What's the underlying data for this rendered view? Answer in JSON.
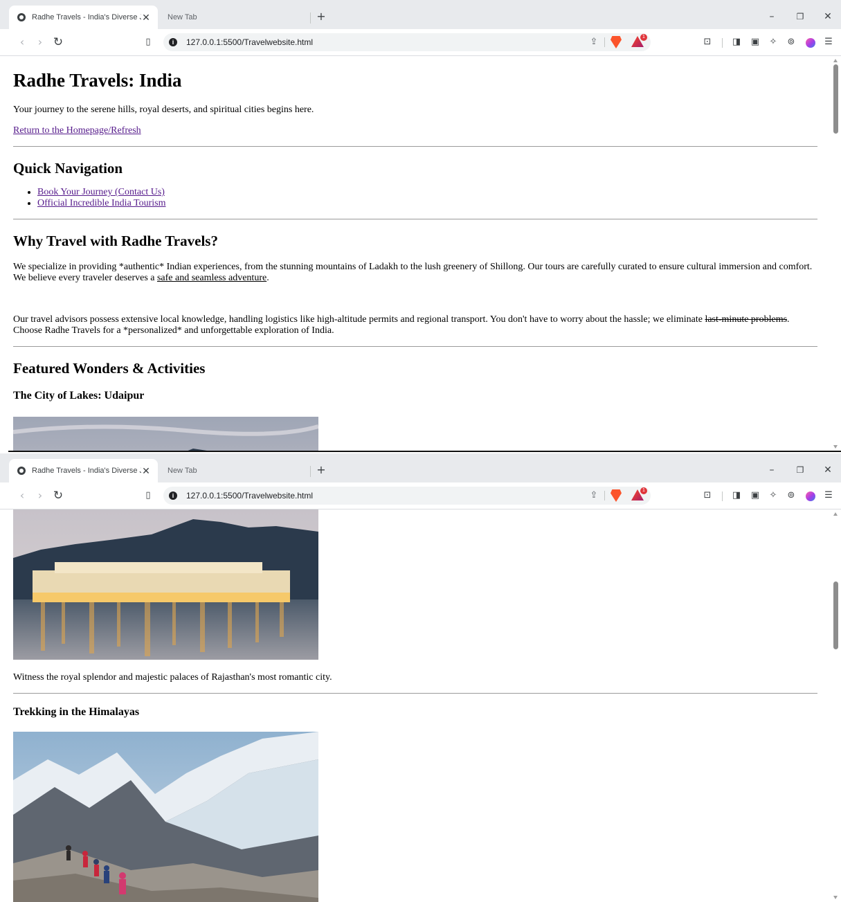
{
  "browser": {
    "active_tab_title": "Radhe Travels - India's Diverse Jo",
    "inactive_tab_title": "New Tab",
    "new_tab_glyph": "+",
    "url": "127.0.0.1:5500/Travelwebsite.html",
    "extension_badge": "1",
    "icons": [
      "globe-icon",
      "close-icon",
      "back-icon",
      "forward-icon",
      "reload-icon",
      "bookmark-icon",
      "site-info-icon",
      "share-icon",
      "brave-shields-icon",
      "brave-rewards-icon",
      "screenshot-icon",
      "sidebar-icon",
      "wallet-icon",
      "leo-ai-icon",
      "vpn-icon",
      "profile-icon",
      "menu-icon"
    ]
  },
  "page": {
    "title": "Radhe Travels: India",
    "tagline": "Your journey to the serene hills, royal deserts, and spiritual cities begins here.",
    "home_link": "Return to the Homepage/Refresh",
    "nav": {
      "heading": "Quick Navigation",
      "links": [
        "Book Your Journey (Contact Us)",
        "Official Incredible India Tourism"
      ]
    },
    "why": {
      "heading": "Why Travel with Radhe Travels?",
      "p1_text": "We specialize in providing *authentic* Indian experiences, from the stunning mountains of Ladakh to the lush greenery of Shillong. Our tours are carefully curated to ensure cultural immersion and comfort. We believe every traveler deserves a ",
      "p1_underline": "safe and seamless adventure",
      "p1_end": ".",
      "p2_text": "Our travel advisors possess extensive local knowledge, handling logistics like high-altitude permits and regional transport. You don't have to worry about the hassle; we eliminate ",
      "p2_strike": "last-minute problems",
      "p2_end": ". Choose Radhe Travels for a *personalized* and unforgettable exploration of India."
    },
    "featured": {
      "heading": "Featured Wonders & Activities",
      "items": [
        {
          "title": "The City of Lakes: Udaipur",
          "image": "lake-palace-photo",
          "caption": "Witness the royal splendor and majestic palaces of Rajasthan's most romantic city."
        },
        {
          "title": "Trekking in the Himalayas",
          "image": "himalaya-trek-photo",
          "caption": ""
        }
      ]
    }
  }
}
